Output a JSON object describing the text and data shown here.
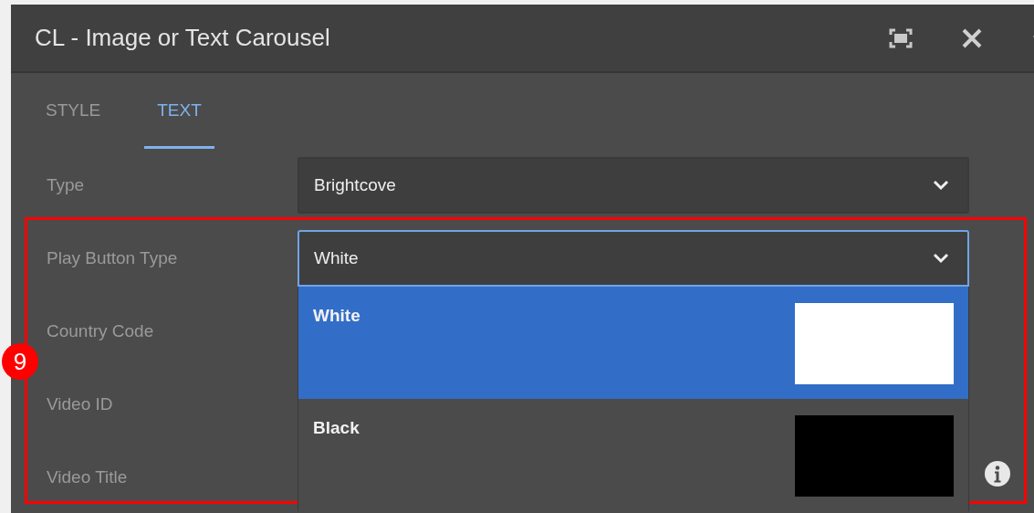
{
  "dialog": {
    "title": "CL - Image or Text Carousel"
  },
  "tabs": [
    {
      "label": "STYLE",
      "selected": false
    },
    {
      "label": "TEXT",
      "selected": true
    }
  ],
  "fields": [
    {
      "label": "Type",
      "kind": "select",
      "value": "Brightcove",
      "focused": false,
      "expanded": false
    },
    {
      "label": "Play Button Type",
      "kind": "select",
      "value": "White",
      "focused": true,
      "expanded": true
    },
    {
      "label": "Country Code",
      "kind": "text"
    },
    {
      "label": "Video ID",
      "kind": "text"
    },
    {
      "label": "Video Title",
      "kind": "text"
    }
  ],
  "dropdown_options": [
    {
      "label": "White",
      "selected": true,
      "color": "#ffffff"
    },
    {
      "label": "Black",
      "selected": false,
      "color": "#000000"
    }
  ],
  "annotation": {
    "label": "9"
  }
}
